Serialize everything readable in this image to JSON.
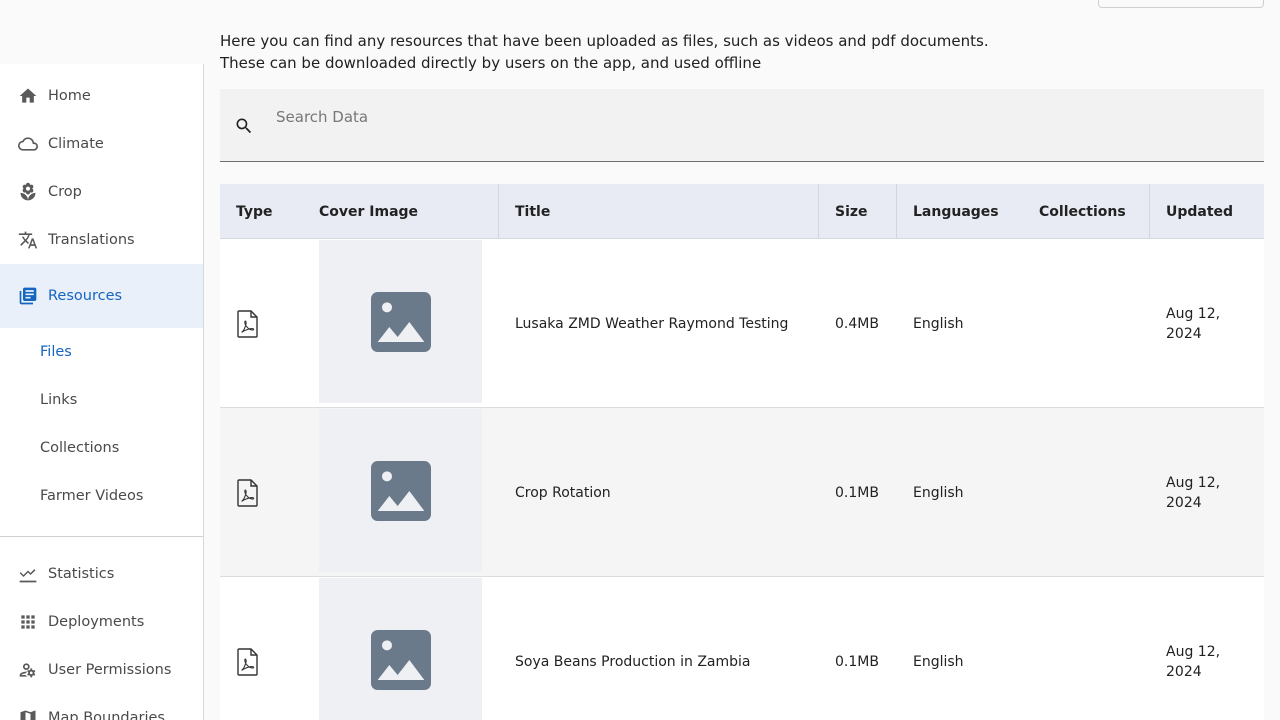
{
  "intro": {
    "line1": "Here you can find any resources that have been uploaded as files, such as videos and pdf documents.",
    "line2": "These can be downloaded directly by users on the app, and used offline"
  },
  "sidebar": {
    "items": [
      {
        "label": "Home",
        "icon": "home-icon"
      },
      {
        "label": "Climate",
        "icon": "cloud-icon"
      },
      {
        "label": "Crop",
        "icon": "sprout-icon"
      },
      {
        "label": "Translations",
        "icon": "translate-icon"
      },
      {
        "label": "Resources",
        "icon": "library-books-icon"
      }
    ],
    "sub_items": [
      {
        "label": "Files"
      },
      {
        "label": "Links"
      },
      {
        "label": "Collections"
      },
      {
        "label": "Farmer Videos"
      }
    ],
    "bottom_items": [
      {
        "label": "Statistics",
        "icon": "chart-line-icon"
      },
      {
        "label": "Deployments",
        "icon": "grid-icon"
      },
      {
        "label": "User Permissions",
        "icon": "user-gear-icon"
      },
      {
        "label": "Map Boundaries",
        "icon": "map-icon"
      }
    ]
  },
  "search": {
    "placeholder": "Search Data",
    "value": ""
  },
  "table": {
    "columns": [
      "Type",
      "Cover Image",
      "Title",
      "Size",
      "Languages",
      "Collections",
      "Updated"
    ],
    "rows": [
      {
        "type": "pdf",
        "title": "Lusaka ZMD Weather Raymond Testing",
        "size": "0.4MB",
        "languages": "English",
        "collections": "",
        "updated_line1": "Aug 12,",
        "updated_line2": "2024"
      },
      {
        "type": "pdf",
        "title": "Crop Rotation",
        "size": "0.1MB",
        "languages": "English",
        "collections": "",
        "updated_line1": "Aug 12,",
        "updated_line2": "2024"
      },
      {
        "type": "pdf",
        "title": "Soya Beans Production in Zambia",
        "size": "0.1MB",
        "languages": "English",
        "collections": "",
        "updated_line1": "Aug 12,",
        "updated_line2": "2024"
      }
    ]
  },
  "colors": {
    "accent": "#1565c0",
    "active_bg": "#e9f0f9",
    "header_bg": "#e8ebf3",
    "placeholder_icon": "#6b7a8b"
  }
}
